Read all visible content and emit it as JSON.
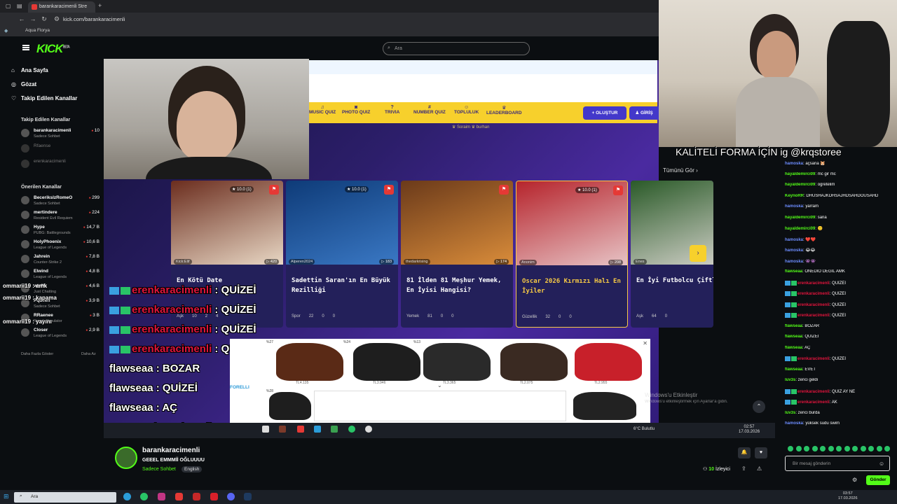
{
  "browser": {
    "tab_title": "barankaracimenli Stre",
    "url": "kick.com/barankaracimenli",
    "bookmark": "Aqua Florya"
  },
  "kick": {
    "logo": "KICK",
    "logo_sup": "BETA",
    "search_placeholder": "Ara"
  },
  "sidebar": {
    "main_items": [
      {
        "label": "Ana Sayfa",
        "icon": "home-icon"
      },
      {
        "label": "Gözat",
        "icon": "browse-icon"
      },
      {
        "label": "Takip Edilen Kanallar",
        "icon": "heart-icon"
      }
    ],
    "followed_heading": "Takip Edilen Kanallar",
    "followed": [
      {
        "name": "barankaracimenli",
        "sub": "Sadece Sohbet",
        "viewers": "10"
      },
      {
        "name": "Rfaense",
        "sub": "",
        "viewers": ""
      },
      {
        "name": "erenkaracimenli",
        "sub": "",
        "viewers": ""
      }
    ],
    "recommended_heading": "Önerilen Kanallar",
    "recommended": [
      {
        "name": "BecerikslzRomeO",
        "sub": "Sadece Sohbet",
        "viewers": "299"
      },
      {
        "name": "mertindere",
        "sub": "Resident Evil Requiem",
        "viewers": "224"
      },
      {
        "name": "Hype",
        "sub": "PUBG: Battlegrounds",
        "viewers": "14,7 B"
      },
      {
        "name": "HolyPhoenix",
        "sub": "League of Legends",
        "viewers": "10,6 B"
      },
      {
        "name": "Jahrein",
        "sub": "Counter-Strike 2",
        "viewers": "7,8 B"
      },
      {
        "name": "Elwind",
        "sub": "League of Legends",
        "viewers": "4,8 B"
      },
      {
        "name": "wtcN",
        "sub": "Just Chatting",
        "viewers": "4,6 B"
      },
      {
        "name": "Pqueen",
        "sub": "Sadece Sohbet",
        "viewers": "3,9 B"
      },
      {
        "name": "RRaenee",
        "sub": "Ranch Simulator",
        "viewers": "3 B"
      },
      {
        "name": "Closer",
        "sub": "League of Legends",
        "viewers": "2,9 B"
      }
    ],
    "show_more": "Daha Fazla Göster",
    "show_less": "Daha Az"
  },
  "left_overlay_lines": [
    {
      "text": "ommarii19 : amk"
    },
    {
      "text": "ommarii19 : kapama"
    },
    {
      "text": "ommarii19 : yayını"
    }
  ],
  "quiz_site": {
    "nav": [
      {
        "label": "MUSIC QUIZ",
        "glyph": "♫"
      },
      {
        "label": "PHOTO QUIZ",
        "glyph": "◙"
      },
      {
        "label": "TRIVIA",
        "glyph": "?"
      },
      {
        "label": "NUMBER QUIZ",
        "glyph": "#"
      },
      {
        "label": "TOPLULUK",
        "glyph": "☺"
      },
      {
        "label": "LEADERBOARD",
        "glyph": "♛"
      }
    ],
    "create_btn": "+ OLUŞTUR",
    "login_btn": "♟ GİRİŞ",
    "tags": "♛ Soraim          ♛ burhan",
    "see_all": "Tümünü Gör  ›",
    "cards": [
      {
        "author": "Kick:Elif",
        "views": "▷ 420",
        "rating": "★ 10.0 (1)",
        "title": "En Kötü Date",
        "category": "Aşk",
        "count": "10",
        "comments": "2",
        "likes": "4",
        "img_from": "#6b2d1e",
        "img_to": "#e8d7c4"
      },
      {
        "author": "Alperen2024",
        "views": "▷ 183",
        "rating": "★ 10.0 (1)",
        "title": "Sadettin Saran'ın En Büyük Rezilliği",
        "category": "Spor",
        "count": "22",
        "comments": "0",
        "likes": "0",
        "img_from": "#0e3b78",
        "img_to": "#3a78c4"
      },
      {
        "author": "thedarkrising",
        "views": "▷ 174",
        "rating": "",
        "title": "81 İlden 81 Meşhur Yemek, En İyisi Hangisi?",
        "category": "Yemek",
        "count": "81",
        "comments": "0",
        "likes": "0",
        "img_from": "#6b3a1a",
        "img_to": "#d98c3a"
      },
      {
        "author": "Anonim",
        "views": "▷ 208",
        "rating": "★ 10.0 (1)",
        "title": "Oscar 2026 Kırmızı Halı En İyiler",
        "category": "Güzellik",
        "count": "32",
        "comments": "0",
        "likes": "0",
        "img_from": "#b6242c",
        "img_to": "#e7c3c5"
      },
      {
        "author": "Enes",
        "views": "",
        "rating": "",
        "title": "En İyi Futbolcu Çiftleri",
        "category": "Aşk",
        "count": "64",
        "comments": "0",
        "likes": "",
        "img_from": "#2a5a28",
        "img_to": "#d9d6d0"
      }
    ]
  },
  "overlay_chat": [
    {
      "user": "erenkaracimenli",
      "msg": " : QUİZEİ",
      "badges": true
    },
    {
      "user": "erenkaracimenli",
      "msg": " : QUİZEİ",
      "badges": true
    },
    {
      "user": "erenkaracimenli",
      "msg": " : QUİZEİ",
      "badges": true
    },
    {
      "user": "erenkaracimenli",
      "msg": " : QUİZEİ",
      "badges": true
    },
    {
      "user": "flawseaa",
      "msg": " : BOZAR",
      "badges": false
    },
    {
      "user": "flawseaa",
      "msg": " : QUİZEİ",
      "badges": false
    },
    {
      "user": "flawseaa",
      "msg": " : AÇ",
      "badges": false
    },
    {
      "user": "erenkaracimenli",
      "msg": " : QUİZEİ",
      "badges": true
    }
  ],
  "ad": {
    "brand": "FORELLI",
    "products": [
      {
        "pct": "%27",
        "price": "TL4.135",
        "color": "#5a2a16"
      },
      {
        "pct": "%24",
        "price": "TL3.946",
        "color": "#1e1e1e"
      },
      {
        "pct": "%13",
        "price": "TL3.365",
        "color": "#2a2a2a"
      },
      {
        "pct": "",
        "price": "TL2.075",
        "color": "#3a2a22"
      },
      {
        "pct": "",
        "price": "TL2.955",
        "color": "#c8202a"
      }
    ],
    "second_row_pct": "%28"
  },
  "windows_watermark": {
    "line1": "Windows'u Etkinleştir",
    "line2": "Windows'u etkinleştirmek için Ayarlar'a gidin."
  },
  "inner_taskbar": {
    "weather": "6°C Bulutlu",
    "time": "02:57",
    "date": "17.03.2026"
  },
  "channel": {
    "name": "barankaracimenli",
    "title": "GEEEL EMMMİİ OĞLUUUU",
    "category": "Sadece Sohbet",
    "language": "English",
    "viewers_count": "10",
    "viewers_label": "İzleyici"
  },
  "cam2_banner": "KALİTELİ FORMA İÇİN ig @krqstoree",
  "chat": {
    "messages": [
      {
        "user": "hamoska",
        "color": "b",
        "msg": ": açsana 🐹",
        "badge": false
      },
      {
        "user": "hayaldemirci09",
        "color": "g",
        "msg": ": mc gir mc",
        "badge": false
      },
      {
        "user": "hayaldemirci09",
        "color": "g",
        "msg": ": ogretelim",
        "badge": false
      },
      {
        "user": "KeynoRR",
        "color": "g",
        "msg": ": DHUSHAJKDHSAJHDSAHDOUSAHD",
        "badge": false
      },
      {
        "user": "hamoska",
        "color": "b",
        "msg": ": yarram",
        "badge": false
      },
      {
        "user": "hayaldemirci09",
        "color": "g",
        "msg": ": sana",
        "badge": false
      },
      {
        "user": "hayaldemirci09",
        "color": "g",
        "msg": ": 🙂",
        "badge": false
      },
      {
        "user": "hamoska",
        "color": "b",
        "msg": ": ❤️❤️",
        "badge": false
      },
      {
        "user": "hamoska",
        "color": "b",
        "msg": ": 😂😂",
        "badge": false
      },
      {
        "user": "hamoska",
        "color": "b",
        "msg": ": 👾👾",
        "badge": false
      },
      {
        "user": "flawseaa",
        "color": "g",
        "msg": ": ONEDİO DEĞİL AMK",
        "badge": false
      },
      {
        "user": "erenkaracimenli",
        "color": "r",
        "msg": ": QUİZEİ",
        "badge": true
      },
      {
        "user": "erenkaracimenli",
        "color": "r",
        "msg": ": QUİZEİ",
        "badge": true
      },
      {
        "user": "erenkaracimenli",
        "color": "r",
        "msg": ": QUİZEİ",
        "badge": true
      },
      {
        "user": "erenkaracimenli",
        "color": "r",
        "msg": ": QUİZEİ",
        "badge": true
      },
      {
        "user": "flawseaa",
        "color": "g",
        "msg": ": BOZAR",
        "badge": false
      },
      {
        "user": "flawseaa",
        "color": "g",
        "msg": ": QUİZEİ",
        "badge": false
      },
      {
        "user": "flawseaa",
        "color": "g",
        "msg": ": AÇ",
        "badge": false
      },
      {
        "user": "erenkaracimenli",
        "color": "r",
        "msg": ": QUİZEİ",
        "badge": true
      },
      {
        "user": "flawseaa",
        "color": "g",
        "msg": ": EVET",
        "badge": false
      },
      {
        "user": "luv3s",
        "color": "g",
        "msg": ": zenci geldi",
        "badge": false
      },
      {
        "user": "erenkaracimenli",
        "color": "r",
        "msg": ": QUİZ AY NE",
        "badge": true
      },
      {
        "user": "erenkaracimenli",
        "color": "r",
        "msg": ": AK",
        "badge": true
      },
      {
        "user": "luv3s",
        "color": "g",
        "msg": ": zenci burda",
        "badge": false
      },
      {
        "user": "hamoska",
        "color": "b",
        "msg": ": yüksek sudu swim",
        "badge": false
      }
    ],
    "input_placeholder": "Bir mesaj gönderin",
    "send": "Gönder"
  },
  "taskbar": {
    "search": "Ara",
    "time": "03:57",
    "date": "17.03.2026"
  }
}
